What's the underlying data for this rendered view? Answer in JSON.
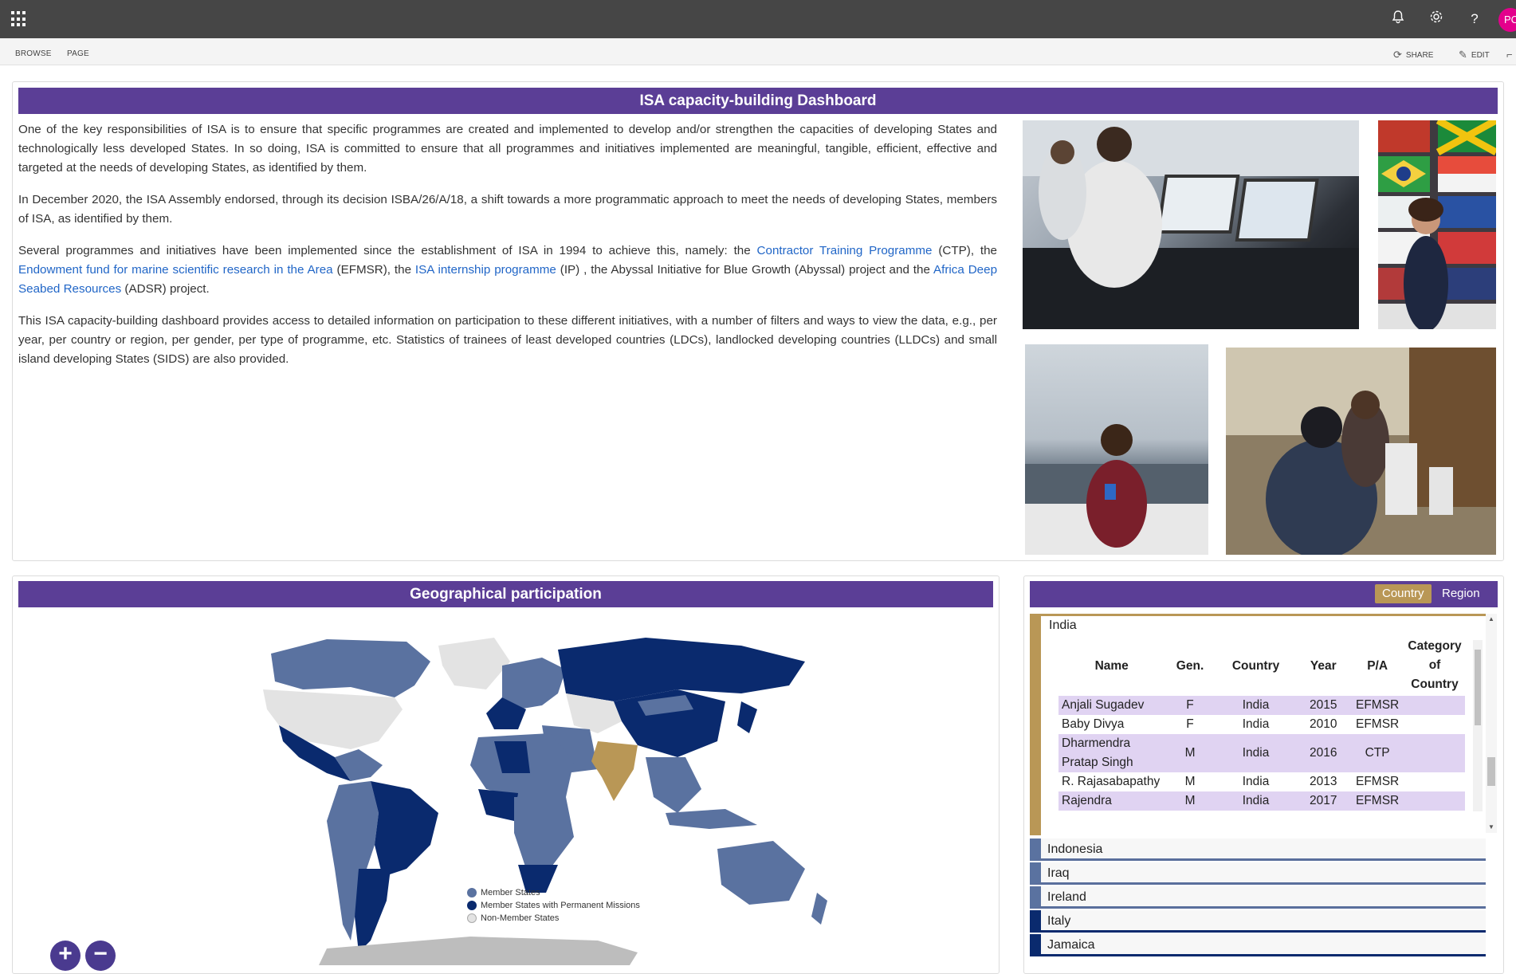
{
  "topbar": {
    "avatar_initials": "PC",
    "icons": [
      "app-launcher-icon",
      "bell-icon",
      "gear-icon",
      "help-icon"
    ]
  },
  "ribbon": {
    "tabs": [
      "BROWSE",
      "PAGE"
    ],
    "share_label": "SHARE",
    "edit_label": "EDIT"
  },
  "intro": {
    "title": "ISA capacity-building Dashboard",
    "p1": "One of the key responsibilities of ISA is to ensure that specific programmes are created and implemented to develop and/or strengthen the capacities of developing States and technologically less developed States. In so doing, ISA is committed to ensure that all programmes and initiatives implemented are meaningful, tangible, efficient, effective and targeted at the needs of developing States, as identified by them.",
    "p2": "In December 2020, the ISA Assembly endorsed, through its decision ISBA/26/A/18, a shift towards a more programmatic approach to meet the needs of developing States, members of ISA, as identified by them.",
    "p3_a": "Several programmes and initiatives have been implemented since the establishment of ISA in 1994 to achieve this, namely: the ",
    "p3_link1": "Contractor Training Programme",
    "p3_b": " (CTP), the ",
    "p3_link2": "Endowment fund for marine scientific research in the Area",
    "p3_c": " (EFMSR), the ",
    "p3_link3": "ISA internship programme",
    "p3_d": " (IP) , the Abyssal Initiative for Blue Growth (Abyssal) project and the ",
    "p3_link4": "Africa Deep Seabed Resources",
    "p3_e": " (ADSR) project.",
    "p4": "This ISA capacity-building dashboard provides access to detailed information on participation to these different initiatives, with a number of filters and ways to view the data, e.g., per year, per country or region, per gender, per type of programme, etc. Statistics of trainees of least developed countries (LDCs), landlocked developing countries (LLDCs) and small island developing States (SIDS) are also provided."
  },
  "map": {
    "title": "Geographical participation",
    "legend": [
      {
        "label": "Member States",
        "color": "#5a72a0"
      },
      {
        "label": "Member States with Permanent Missions",
        "color": "#0a2a6e"
      },
      {
        "label": "Non-Member States",
        "color": "#e3e3e3"
      }
    ],
    "highlight_color": "#b99756",
    "zoom_in": "+",
    "zoom_out": "−"
  },
  "participants": {
    "toggle": {
      "active": "Country",
      "inactive": "Region"
    },
    "expanded_country": "India",
    "columns": [
      "Name",
      "Gen.",
      "Country",
      "Year",
      "P/A",
      "Category of Country"
    ],
    "rows": [
      {
        "name": "Anjali Sugadev",
        "gen": "F",
        "country": "India",
        "year": "2015",
        "pa": "EFMSR",
        "cat": ""
      },
      {
        "name": "Baby Divya",
        "gen": "F",
        "country": "India",
        "year": "2010",
        "pa": "EFMSR",
        "cat": ""
      },
      {
        "name": "Dharmendra Pratap Singh",
        "gen": "M",
        "country": "India",
        "year": "2016",
        "pa": "CTP",
        "cat": ""
      },
      {
        "name": "R. Rajasabapathy",
        "gen": "M",
        "country": "India",
        "year": "2013",
        "pa": "EFMSR",
        "cat": ""
      },
      {
        "name": "Rajendra",
        "gen": "M",
        "country": "India",
        "year": "2017",
        "pa": "EFMSR",
        "cat": ""
      }
    ],
    "other_countries": [
      "Indonesia",
      "Iraq",
      "Ireland",
      "Italy",
      "Jamaica"
    ]
  }
}
